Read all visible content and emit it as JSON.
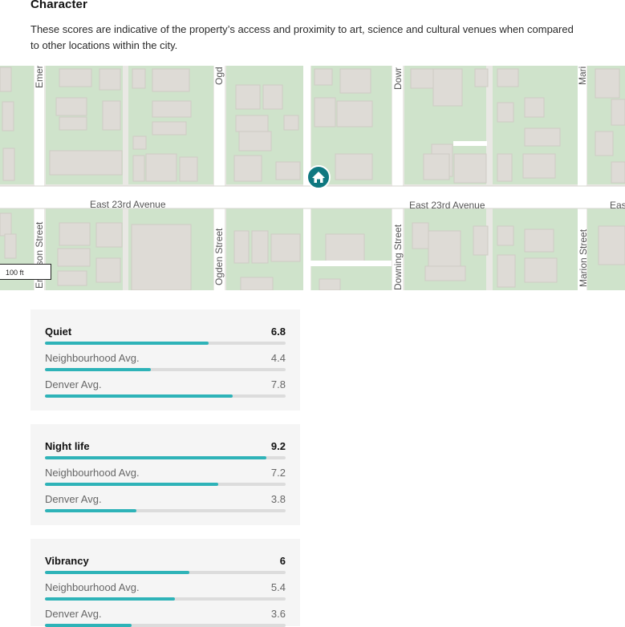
{
  "header": {
    "title": "Character",
    "description": "These scores are indicative of the property’s access and proximity to art, science and cultural venues when compared to other locations within the city."
  },
  "map": {
    "streets": {
      "east_23rd_avenue": "East 23rd Avenue",
      "east_23rd_avenue_right": "East 23rd Avenue",
      "east_partial": "Eas",
      "emerson_top": "Emer",
      "emerson_bottom": "Emerson Street",
      "ogden_top": "Ogd",
      "ogden_bottom": "Ogden Street",
      "downing_top": "Dowr",
      "downing_bottom": "Downing Street",
      "marion_top": "Mari",
      "marion_bottom": "Marion Street"
    },
    "scale": "100 ft",
    "marker_icon": "home-icon",
    "colors": {
      "marker": "#0f7880",
      "park": "#cfe3cb",
      "building": "#dedbd6",
      "road": "#ffffff"
    }
  },
  "scores": [
    {
      "title": "Quiet",
      "value": "6.8",
      "fraction": 0.68,
      "neighbourhood_label": "Neighbourhood Avg.",
      "neighbourhood_value": "4.4",
      "neighbourhood_fraction": 0.44,
      "denver_label": "Denver Avg.",
      "denver_value": "7.8",
      "denver_fraction": 0.78
    },
    {
      "title": "Night life",
      "value": "9.2",
      "fraction": 0.92,
      "neighbourhood_label": "Neighbourhood Avg.",
      "neighbourhood_value": "7.2",
      "neighbourhood_fraction": 0.72,
      "denver_label": "Denver Avg.",
      "denver_value": "3.8",
      "denver_fraction": 0.38
    },
    {
      "title": "Vibrancy",
      "value": "6",
      "fraction": 0.6,
      "neighbourhood_label": "Neighbourhood Avg.",
      "neighbourhood_value": "5.4",
      "neighbourhood_fraction": 0.54,
      "denver_label": "Denver Avg.",
      "denver_value": "3.6",
      "denver_fraction": 0.36
    }
  ],
  "accent_color": "#2eb3b8"
}
